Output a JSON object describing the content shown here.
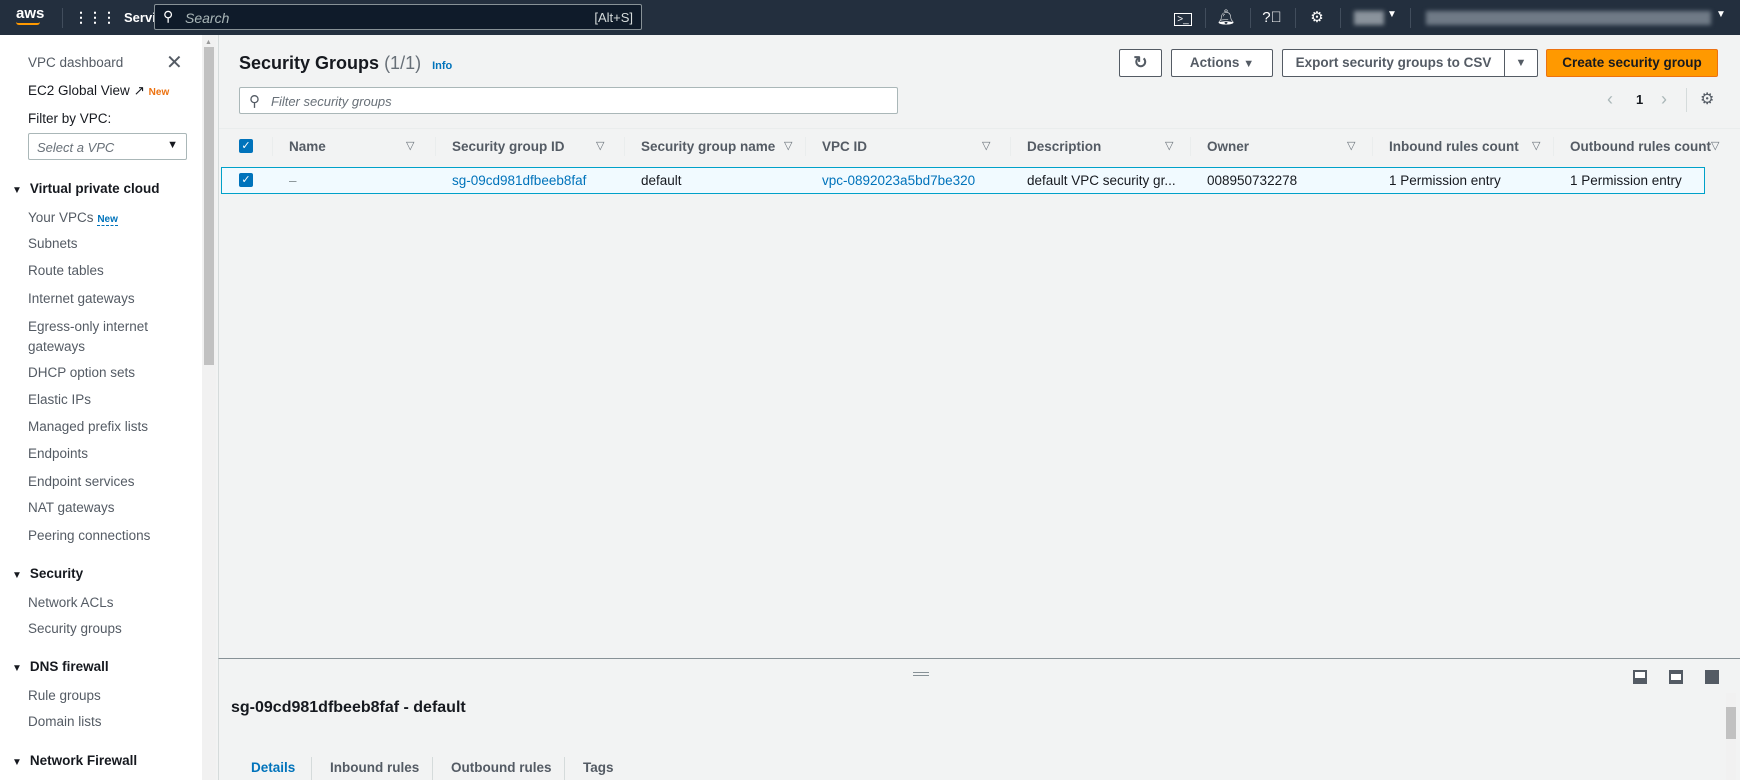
{
  "topbar": {
    "logo": "aws",
    "services": "Services",
    "search_placeholder": "Search",
    "search_shortcut": "[Alt+S]"
  },
  "sidebar": {
    "dashboard": "VPC dashboard",
    "global_view": "EC2 Global View",
    "new_badge": "New",
    "filter_label": "Filter by VPC:",
    "select_placeholder": "Select a VPC",
    "sections": [
      {
        "title": "Virtual private cloud",
        "items": [
          "Your VPCs",
          "Subnets",
          "Route tables",
          "Internet gateways",
          "Egress-only internet gateways",
          "DHCP option sets",
          "Elastic IPs",
          "Managed prefix lists",
          "Endpoints",
          "Endpoint services",
          "NAT gateways",
          "Peering connections"
        ]
      },
      {
        "title": "Security",
        "items": [
          "Network ACLs",
          "Security groups"
        ]
      },
      {
        "title": "DNS firewall",
        "items": [
          "Rule groups",
          "Domain lists"
        ]
      },
      {
        "title": "Network Firewall",
        "items": []
      }
    ]
  },
  "main": {
    "title": "Security Groups",
    "count": "(1/1)",
    "info": "Info",
    "actions": "Actions",
    "export": "Export security groups to CSV",
    "create": "Create security group",
    "filter_placeholder": "Filter security groups",
    "page": "1",
    "columns": [
      "Name",
      "Security group ID",
      "Security group name",
      "VPC ID",
      "Description",
      "Owner",
      "Inbound rules count",
      "Outbound rules count"
    ],
    "rows": [
      [
        "–",
        "sg-09cd981dfbeeb8faf",
        "default",
        "vpc-0892023a5bd7be320",
        "default VPC security gr...",
        "008950732278",
        "1 Permission entry",
        "1 Permission entry"
      ]
    ]
  },
  "details": {
    "title": "sg-09cd981dfbeeb8faf - default",
    "tabs": [
      "Details",
      "Inbound rules",
      "Outbound rules",
      "Tags"
    ]
  },
  "colors": {
    "header": "#232f3e",
    "accent": "#ff9900",
    "link": "#0073bb"
  }
}
